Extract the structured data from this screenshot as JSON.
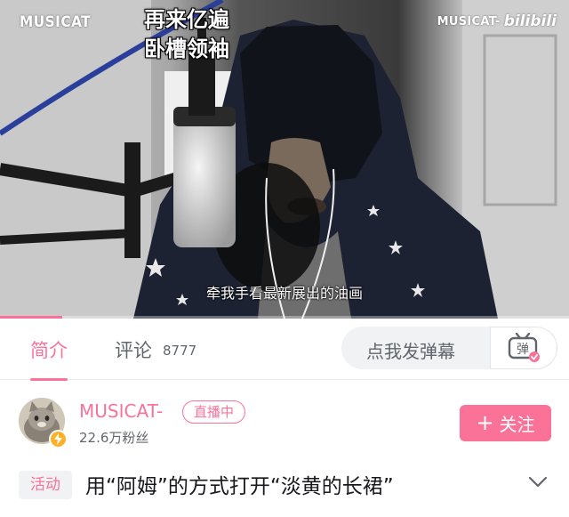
{
  "video": {
    "watermark_left": "MUSICAT",
    "watermark_right_name": "MUSICAT-",
    "watermark_right_logo": "bilibili",
    "subtitle_top_line1": "再来亿遍",
    "subtitle_top_line2": "卧槽领袖",
    "subtitle_bottom": "牵我手看最新展出的油画",
    "progress": 0.11
  },
  "tabs": [
    {
      "label": "简介",
      "active": true
    },
    {
      "label": "评论",
      "count": "8777",
      "active": false
    }
  ],
  "danmaku": {
    "placeholder": "点我发弹幕",
    "toggle_label": "弹",
    "toggle_icon": "danmaku-toggle-icon"
  },
  "uploader": {
    "name": "MUSICAT-",
    "live_badge": "直播中",
    "fans": "22.6万粉丝",
    "follow_label": "关注",
    "follow_icon": "+"
  },
  "video_info": {
    "tag": "活动",
    "title": "用“阿姆”的方式打开“淡黄的长裙”"
  },
  "colors": {
    "accent": "#fb7299",
    "text": "#18191c",
    "muted": "#61666d",
    "chip_bg": "#f1f2f3"
  }
}
